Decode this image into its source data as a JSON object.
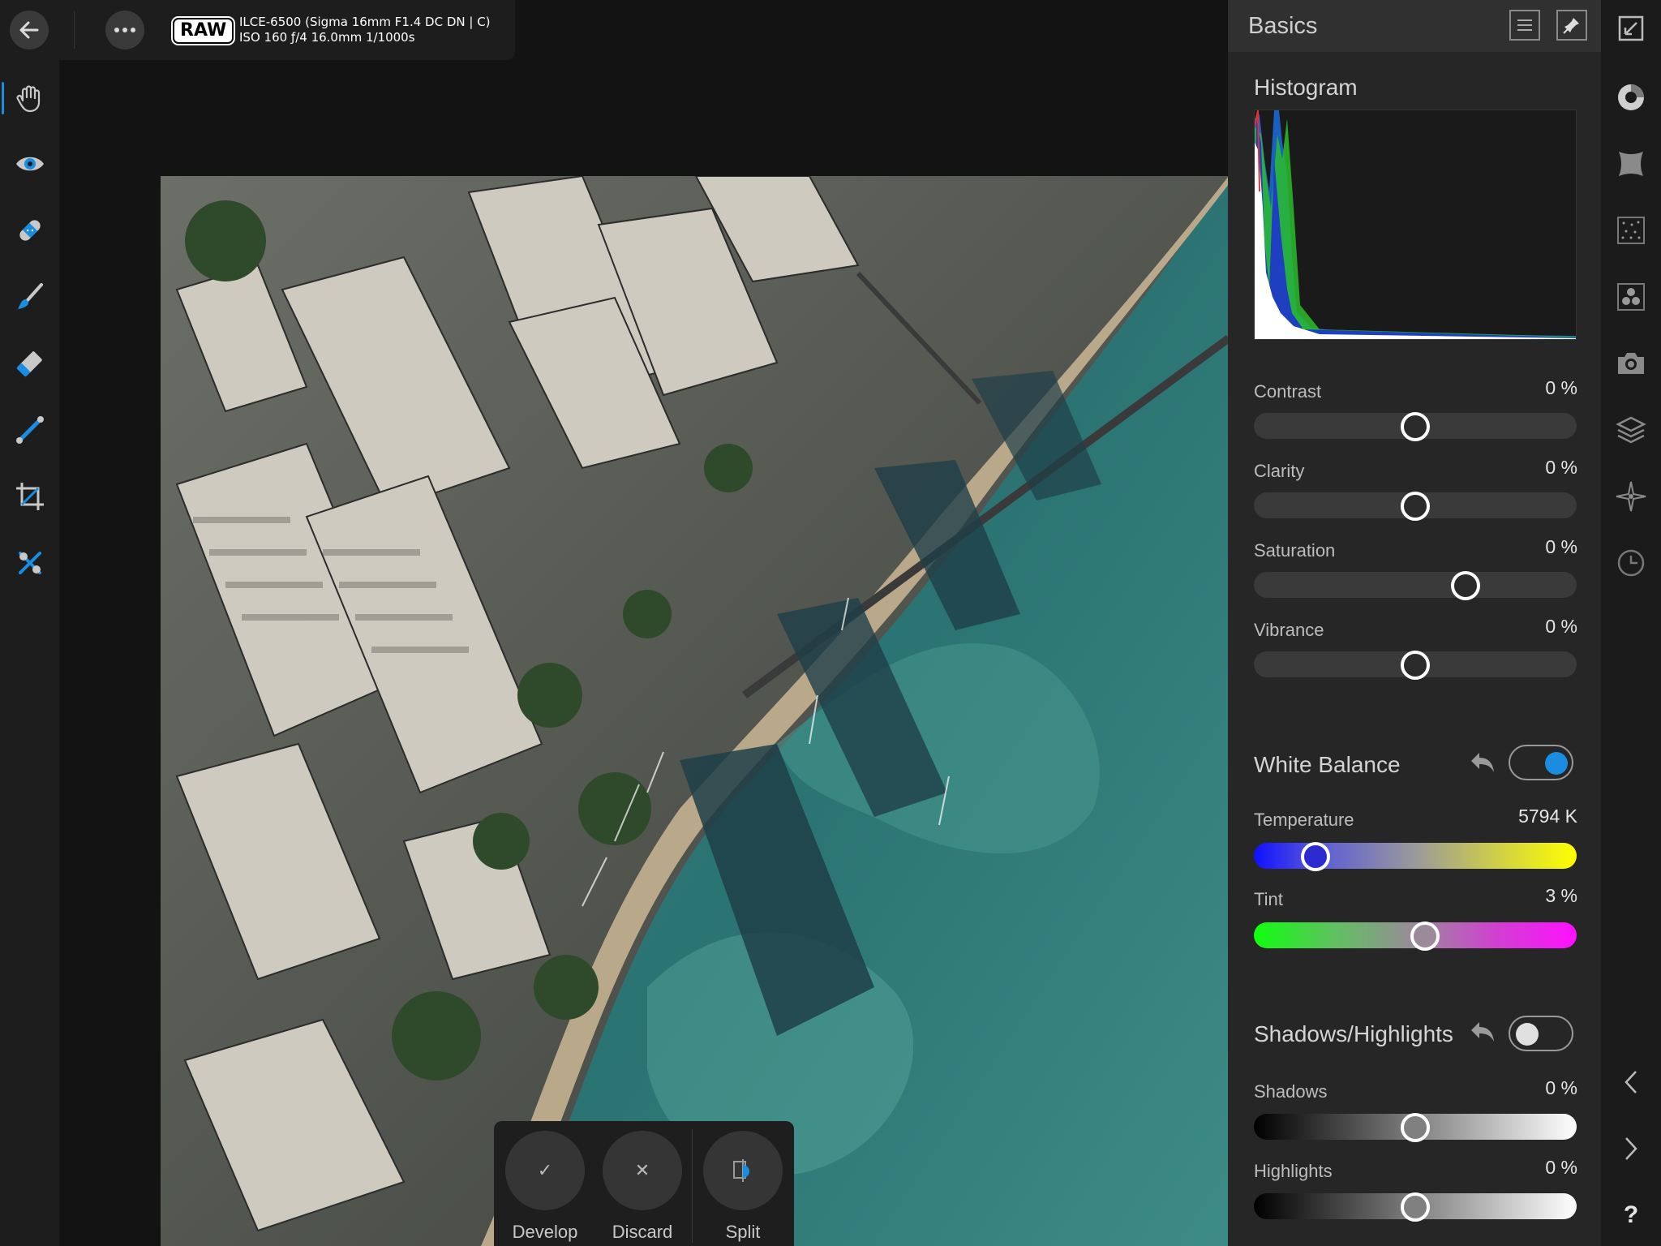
{
  "top_bar": {
    "raw_badge": "RAW",
    "camera_line1": "ILCE-6500 (Sigma 16mm F1.4 DC DN | C)",
    "camera_line2": "ISO 160 ƒ/4 16.0mm 1/1000s"
  },
  "tools": [
    "hand-tool",
    "view-tool",
    "blemish-tool",
    "brush-tool",
    "erase-tool",
    "gradient-tool",
    "crop-tool",
    "red-eye-tool"
  ],
  "develop_bar": {
    "develop_label": "Develop",
    "discard_label": "Discard",
    "split_label": "Split"
  },
  "panel": {
    "title": "Basics",
    "histogram_title": "Histogram",
    "basic_sliders": [
      {
        "label": "Contrast",
        "value": "0 %",
        "position": 0.5
      },
      {
        "label": "Clarity",
        "value": "0 %",
        "position": 0.5
      },
      {
        "label": "Saturation",
        "value": "0 %",
        "position": 0.655
      },
      {
        "label": "Vibrance",
        "value": "0 %",
        "position": 0.5
      }
    ],
    "white_balance": {
      "title": "White Balance",
      "enabled": true,
      "temperature_label": "Temperature",
      "temperature_value": "5794 K",
      "temperature_position": 0.19,
      "tint_label": "Tint",
      "tint_value": "3 %",
      "tint_position": 0.53
    },
    "shadows_highlights": {
      "title": "Shadows/Highlights",
      "enabled": false,
      "shadows_label": "Shadows",
      "shadows_value": "0 %",
      "shadows_position": 0.5,
      "highlights_label": "Highlights",
      "highlights_value": "0 %",
      "highlights_position": 0.5
    }
  },
  "colors": {
    "accent": "#1a8de0",
    "panel_bg": "#262626",
    "canvas_bg": "#131313"
  },
  "studio_icons": [
    "color-wheel-icon",
    "perspective-icon",
    "noise-icon",
    "channels-icon",
    "camera-icon",
    "layers-icon",
    "navigator-icon",
    "history-icon",
    "chevron-left-icon",
    "chevron-right-icon",
    "help-icon"
  ],
  "help_label": "?"
}
